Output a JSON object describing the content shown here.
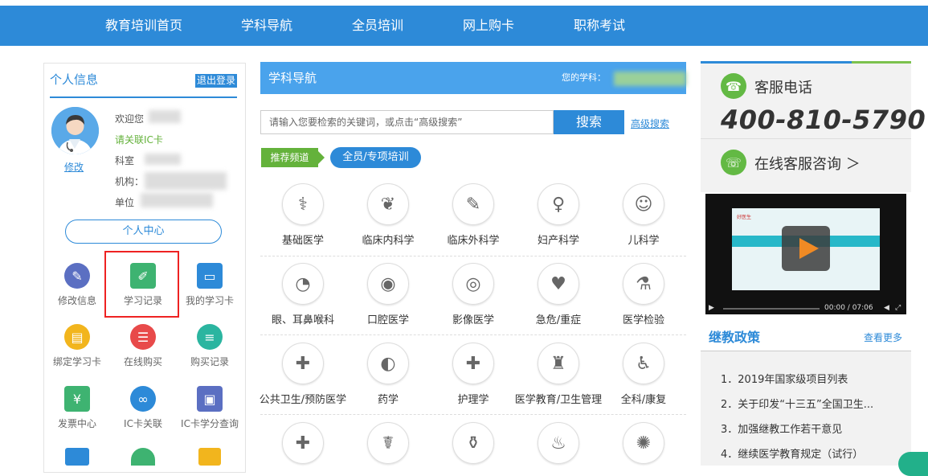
{
  "colors": {
    "primary": "#2d8ad8",
    "header_bar": "#4aa3ec",
    "green": "#64b23b",
    "highlight": "#e22222"
  },
  "nav": [
    "教育培训首页",
    "学科导航",
    "全员培训",
    "网上购卡",
    "职称考试"
  ],
  "profile": {
    "title": "个人信息",
    "logout": "退出登录",
    "welcome": "欢迎您",
    "link_ic": "请关联IC卡",
    "dept": "科室",
    "org": "机构：",
    "unit": "单位",
    "edit": "修改",
    "center": "个人中心"
  },
  "grid": [
    {
      "label": "修改信息",
      "icon": "edit-icon",
      "color": "#5b6fc2"
    },
    {
      "label": "学习记录",
      "icon": "bookmark-icon",
      "color": "#3eb371"
    },
    {
      "label": "我的学习卡",
      "icon": "card-icon",
      "color": "#2d8ad8"
    },
    {
      "label": "绑定学习卡",
      "icon": "bind-card-icon",
      "color": "#f2b51d"
    },
    {
      "label": "在线购买",
      "icon": "cart-icon",
      "color": "#e84a4a"
    },
    {
      "label": "购买记录",
      "icon": "list-icon",
      "color": "#2bb5a0"
    },
    {
      "label": "发票中心",
      "icon": "invoice-icon",
      "color": "#3eb371"
    },
    {
      "label": "IC卡关联",
      "icon": "link-icon",
      "color": "#2d8ad8"
    },
    {
      "label": "IC卡学分查询",
      "icon": "credit-query-icon",
      "color": "#5b6fc2"
    }
  ],
  "subject_nav": {
    "title": "学科导航",
    "your_subject": "您的学科：",
    "search_placeholder": "请输入您要检索的关键词，或点击“高级搜索”",
    "search_btn": "搜索",
    "advanced": "高级搜索",
    "recommend": "推荐频道",
    "chip": "全员/专项培训"
  },
  "subjects": [
    {
      "label": "基础医学",
      "icon": "stethoscope-icon",
      "glyph": "⚕"
    },
    {
      "label": "临床内科学",
      "icon": "lungs-icon",
      "glyph": "❦"
    },
    {
      "label": "临床外科学",
      "icon": "scalpel-icon",
      "glyph": "✎"
    },
    {
      "label": "妇产科学",
      "icon": "fetus-icon",
      "glyph": "♀"
    },
    {
      "label": "儿科学",
      "icon": "baby-icon",
      "glyph": "☺"
    },
    {
      "label": "眼、耳鼻喉科",
      "icon": "ear-icon",
      "glyph": "◔"
    },
    {
      "label": "口腔医学",
      "icon": "mouth-icon",
      "glyph": "◉"
    },
    {
      "label": "影像医学",
      "icon": "scanner-icon",
      "glyph": "◎"
    },
    {
      "label": "急危/重症",
      "icon": "ecg-icon",
      "glyph": "♥"
    },
    {
      "label": "医学检验",
      "icon": "flask-icon",
      "glyph": "⚗"
    },
    {
      "label": "公共卫生/预防医学",
      "icon": "shield-icon",
      "glyph": "✚"
    },
    {
      "label": "药学",
      "icon": "pill-icon",
      "glyph": "◐"
    },
    {
      "label": "护理学",
      "icon": "nurse-cross-icon",
      "glyph": "✚"
    },
    {
      "label": "医学教育/卫生管理",
      "icon": "microscope-icon",
      "glyph": "♜"
    },
    {
      "label": "全科/康复",
      "icon": "elder-icon",
      "glyph": "♿"
    },
    {
      "label": "",
      "icon": "first-aid-kit-icon",
      "glyph": "✚"
    },
    {
      "label": "",
      "icon": "doctor-icon",
      "glyph": "☤"
    },
    {
      "label": "",
      "icon": "iv-bag-icon",
      "glyph": "⚱"
    },
    {
      "label": "",
      "icon": "apple-icon",
      "glyph": "♨"
    },
    {
      "label": "",
      "icon": "virus-icon",
      "glyph": "✺"
    }
  ],
  "service": {
    "hotline_label": "客服电话",
    "phone": "400-810-5790",
    "online": "在线客服咨询 ＞"
  },
  "video": {
    "caption": "好医生",
    "time": "00:00 / 07:06"
  },
  "policy": {
    "title": "继教政策",
    "more": "查看更多",
    "items": [
      "1．2019年国家级项目列表",
      "2．关于印发“十三五”全国卫生...",
      "3．加强继教工作若干意见",
      "4．继续医学教育规定（试行）"
    ]
  }
}
